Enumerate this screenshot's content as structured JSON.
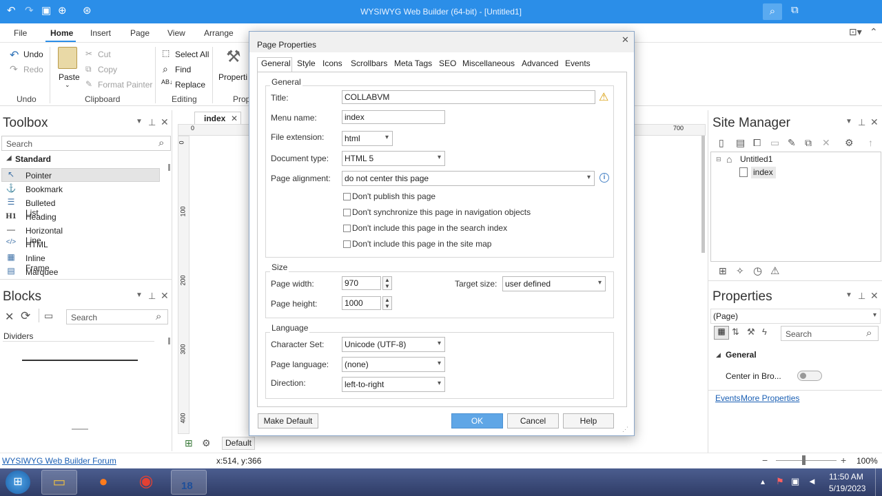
{
  "window": {
    "title": "WYSIWYG Web Builder (64-bit) - [Untitled1]"
  },
  "menu": [
    "File",
    "Home",
    "Insert",
    "Page",
    "View",
    "Arrange"
  ],
  "ribbon": {
    "undo": "Undo",
    "redo": "Redo",
    "paste": "Paste",
    "cut": "Cut",
    "copy": "Copy",
    "format_painter": "Format Painter",
    "select_all": "Select All",
    "find": "Find",
    "replace": "Replace",
    "properties": "Properti",
    "groups": {
      "undo": "Undo",
      "clipboard": "Clipboard",
      "editing": "Editing",
      "prop": "Prop"
    }
  },
  "toolbox": {
    "title": "Toolbox",
    "search_placeholder": "Search",
    "section": "Standard",
    "items": [
      {
        "label": "Pointer",
        "icon": "↖"
      },
      {
        "label": "Bookmark",
        "icon": "⚓"
      },
      {
        "label": "Bulleted List",
        "icon": "☰"
      },
      {
        "label": "Heading",
        "icon": "H1"
      },
      {
        "label": "Horizontal Line",
        "icon": "—"
      },
      {
        "label": "HTML",
        "icon": "</>"
      },
      {
        "label": "Inline Frame",
        "icon": "▦"
      },
      {
        "label": "Marquee",
        "icon": "▤"
      }
    ]
  },
  "blocks": {
    "title": "Blocks",
    "search_placeholder": "Search",
    "section": "Dividers"
  },
  "doc_tab": "index",
  "ruler": {
    "top_start": "0",
    "top_end": "700",
    "left": [
      "0",
      "100",
      "200",
      "300",
      "400"
    ]
  },
  "bottom_tabs": {
    "default": "Default"
  },
  "site_manager": {
    "title": "Site Manager",
    "root": "Untitled1",
    "child": "index"
  },
  "properties": {
    "title": "Properties",
    "selector": "(Page)",
    "search_placeholder": "Search",
    "section": "General",
    "row_label": "Center in Bro...",
    "link_events": "Events",
    "link_more": "More Properties"
  },
  "dialog": {
    "title": "Page Properties",
    "tabs": [
      "General",
      "Style",
      "Icons",
      "Scrollbars",
      "Meta Tags",
      "SEO",
      "Miscellaneous",
      "Advanced",
      "Events"
    ],
    "general_group": "General",
    "title_label": "Title:",
    "title_value": "COLLABVM",
    "menu_label": "Menu name:",
    "menu_value": "index",
    "ext_label": "File extension:",
    "ext_value": "html",
    "doctype_label": "Document type:",
    "doctype_value": "HTML 5",
    "align_label": "Page alignment:",
    "align_value": "do not center this page",
    "checks": [
      "Don't publish this page",
      "Don't synchronize this page in navigation objects",
      "Don't include this page in the search index",
      "Don't include this page in the site map"
    ],
    "size_group": "Size",
    "width_label": "Page width:",
    "width_value": "970",
    "height_label": "Page height:",
    "height_value": "1000",
    "target_label": "Target size:",
    "target_value": "user defined",
    "lang_group": "Language",
    "charset_label": "Character Set:",
    "charset_value": "Unicode (UTF-8)",
    "pagelang_label": "Page language:",
    "pagelang_value": "(none)",
    "dir_label": "Direction:",
    "dir_value": "left-to-right",
    "make_default": "Make Default",
    "ok": "OK",
    "cancel": "Cancel",
    "help": "Help"
  },
  "status": {
    "forum_link": "WYSIWYG Web Builder Forum",
    "coords": "x:514, y:366",
    "zoom": "100%"
  },
  "taskbar": {
    "time": "11:50 AM",
    "date": "5/19/2023",
    "badge": "18"
  }
}
